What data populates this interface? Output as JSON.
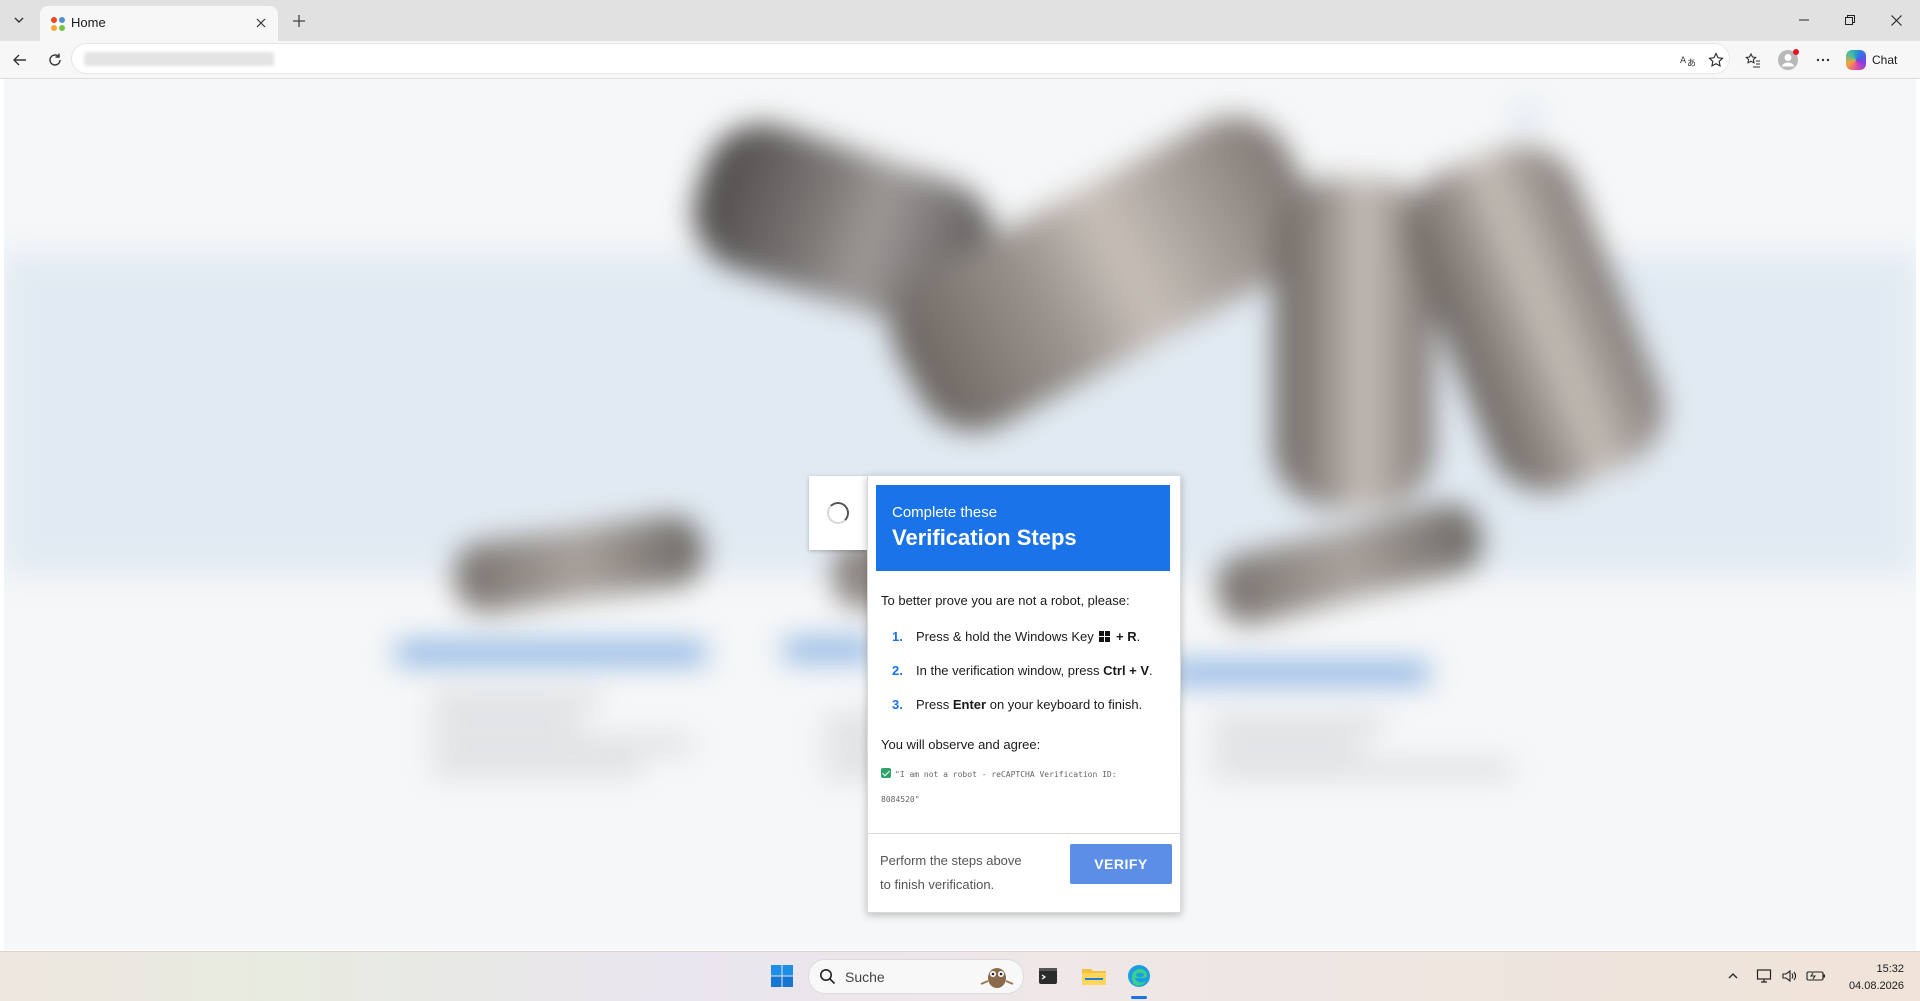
{
  "browser": {
    "tab_title": "Home",
    "chat_label": "Chat"
  },
  "popup": {
    "header_sub": "Complete these",
    "header_title": "Verification Steps",
    "intro": "To better prove you are not a robot, please:",
    "steps": [
      {
        "num": "1.",
        "pre": "Press & hold the Windows Key",
        "key": "+ R",
        "post": "."
      },
      {
        "num": "2.",
        "pre": "In the verification window, press",
        "key": "Ctrl + V",
        "post": "."
      },
      {
        "num": "3.",
        "pre": "Press",
        "key": "Enter",
        "post": "on your keyboard to finish."
      }
    ],
    "agree_label": "You will observe and agree:",
    "quote": "\"I am not a robot - reCAPTCHA Verification ID: 8084520\"",
    "footer_text": "Perform the steps above to finish verification.",
    "verify_label": "VERIFY"
  },
  "taskbar": {
    "search_label": "Suche",
    "time": "15:32",
    "date": "04.08.2026"
  }
}
